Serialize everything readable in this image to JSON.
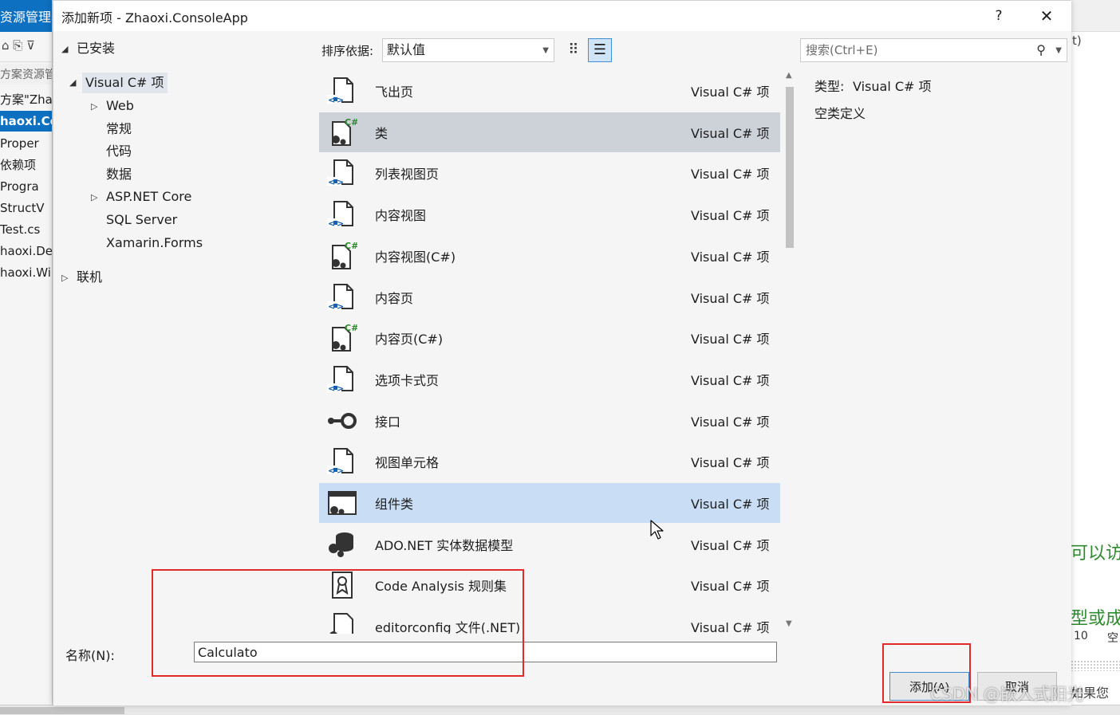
{
  "background": {
    "left": {
      "title": "资源管理器",
      "search": "方案资源管",
      "rows": [
        "方案\"Zha",
        "haoxi.Co",
        "Proper",
        "依赖项",
        "Progra",
        "StructV",
        "Test.cs",
        "haoxi.De",
        "haoxi.Wi"
      ]
    },
    "right": {
      "top_text": "t)",
      "green_1": "可以访问",
      "green_2": "型或成",
      "number": "10",
      "col": "空",
      "bottom_text": "如果您"
    }
  },
  "dialog": {
    "title": "添加新项 - Zhaoxi.ConsoleApp",
    "help": "?",
    "close": "✕",
    "tree": {
      "installed": "已安装",
      "visual_csharp": "Visual C# 项",
      "web": "Web",
      "general": "常规",
      "code": "代码",
      "data": "数据",
      "aspnet": "ASP.NET Core",
      "sql": "SQL Server",
      "xamarin": "Xamarin.Forms",
      "online": "联机"
    },
    "toolbar": {
      "sort_label": "排序依据:",
      "sort_value": "默认值",
      "search_placeholder": "搜索(Ctrl+E)"
    },
    "templates": [
      {
        "name": "飞出页",
        "lang": "Visual C# 项",
        "icon": "page-icon"
      },
      {
        "name": "类",
        "lang": "Visual C# 项",
        "icon": "csharp-class-icon"
      },
      {
        "name": "列表视图页",
        "lang": "Visual C# 项",
        "icon": "page-icon"
      },
      {
        "name": "内容视图",
        "lang": "Visual C# 项",
        "icon": "page-icon"
      },
      {
        "name": "内容视图(C#)",
        "lang": "Visual C# 项",
        "icon": "csharp-class-icon"
      },
      {
        "name": "内容页",
        "lang": "Visual C# 项",
        "icon": "page-icon"
      },
      {
        "name": "内容页(C#)",
        "lang": "Visual C# 项",
        "icon": "csharp-class-icon"
      },
      {
        "name": "选项卡式页",
        "lang": "Visual C# 项",
        "icon": "page-icon"
      },
      {
        "name": "接口",
        "lang": "Visual C# 项",
        "icon": "interface-icon"
      },
      {
        "name": "视图单元格",
        "lang": "Visual C# 项",
        "icon": "page-icon"
      },
      {
        "name": "组件类",
        "lang": "Visual C# 项",
        "icon": "component-icon"
      },
      {
        "name": "ADO.NET 实体数据模型",
        "lang": "Visual C# 项",
        "icon": "ado-icon"
      },
      {
        "name": "Code Analysis 规则集",
        "lang": "Visual C# 项",
        "icon": "ruleset-icon"
      },
      {
        "name": "editorconfig 文件(.NET)",
        "lang": "Visual C# 项",
        "icon": "editorconfig-icon"
      }
    ],
    "info": {
      "type_label": "类型:",
      "type_value": "Visual C# 项",
      "description": "空类定义"
    },
    "name": {
      "label": "名称(N):",
      "value": "Calculato"
    },
    "buttons": {
      "add": "添加(A)",
      "cancel": "取消"
    }
  },
  "watermark": "CSDN @嵌入式阳光",
  "colors": {
    "accent": "#0e70c0",
    "selected_row": "#cdd1d8",
    "hover_row": "#c9def5",
    "annotation": "#e32a2a"
  }
}
